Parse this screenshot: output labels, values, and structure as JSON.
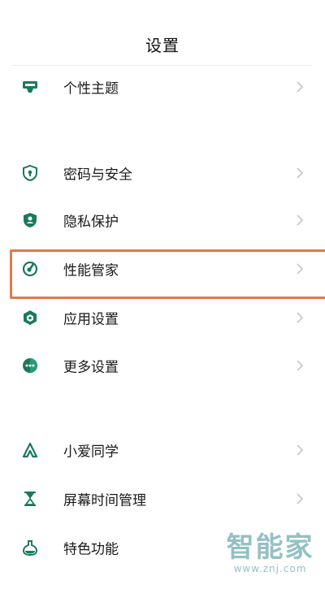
{
  "header": {
    "title": "设置"
  },
  "settings_items": [
    {
      "label": "个性主题",
      "icon": "theme-icon"
    },
    {
      "label": "密码与安全",
      "icon": "shield-lock-icon"
    },
    {
      "label": "隐私保护",
      "icon": "privacy-shield-icon"
    },
    {
      "label": "性能管家",
      "icon": "performance-gauge-icon"
    },
    {
      "label": "应用设置",
      "icon": "hexagon-app-icon"
    },
    {
      "label": "更多设置",
      "icon": "more-dots-icon"
    },
    {
      "label": "小爱同学",
      "icon": "xiaoai-icon"
    },
    {
      "label": "屏幕时间管理",
      "icon": "hourglass-icon"
    },
    {
      "label": "特色功能",
      "icon": "flask-icon"
    }
  ],
  "highlighted_item": "性能管家",
  "colors": {
    "icon_green": "#1a7a5a",
    "highlight_border": "#e07a45",
    "chevron": "#c6c6c6"
  },
  "watermark": {
    "main": "智能家",
    "url": "www.znj.com"
  }
}
